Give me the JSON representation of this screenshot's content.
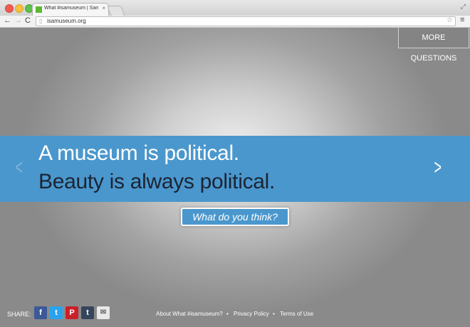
{
  "browser": {
    "tab_title": "What #isamuseum | Sam",
    "tab_close": "×",
    "url": "isamuseum.org",
    "icons": [
      "back-arrow-icon",
      "forward-arrow-icon",
      "reload-icon",
      "page-icon",
      "star-icon",
      "menu-icon",
      "fullscreen-icon"
    ],
    "back": "←",
    "forward": "→",
    "reload": "C",
    "star": "☆",
    "menu": "≡",
    "fullscreen": "⤢"
  },
  "page": {
    "more_questions": "MORE QUESTIONS",
    "line1": "A museum is political.",
    "line2": "Beauty is always political.",
    "arrow_left": "<",
    "arrow_right": ">",
    "cta": "What do you think?",
    "share_label": "SHARE:",
    "share": {
      "facebook": "f",
      "twitter": "t",
      "pinterest": "P",
      "tumblr": "t",
      "mail": "✉"
    },
    "footer": {
      "about": "About What #isamuseum?",
      "privacy": "Privacy Policy",
      "terms": "Terms of Use",
      "separator": "•"
    },
    "colors": {
      "band": "#4a97cd",
      "line2": "#1c2433"
    }
  }
}
